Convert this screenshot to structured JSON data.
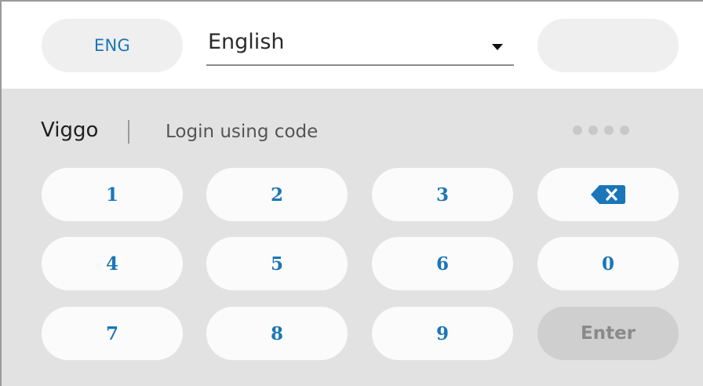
{
  "header": {
    "language_code": "ENG",
    "language_selected": "English"
  },
  "login": {
    "user_name": "Viggo",
    "method_label": "Login using code",
    "pin_length": 4
  },
  "keypad": {
    "row1": [
      "1",
      "2",
      "3"
    ],
    "row2": [
      "4",
      "5",
      "6",
      "0"
    ],
    "row3": [
      "7",
      "8",
      "9"
    ],
    "enter_label": "Enter"
  },
  "colors": {
    "accent": "#1a76b8",
    "keypad_background": "#e2e2e2",
    "key_background": "#fbfbfb",
    "enter_background": "#cfcfcf"
  }
}
